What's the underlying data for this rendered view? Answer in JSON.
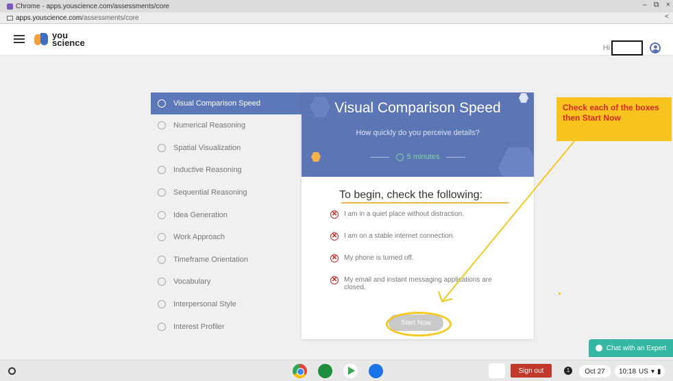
{
  "browser": {
    "title": "Chrome - apps.youscience.com/assessments/core",
    "url_domain": "apps.youscience.com",
    "url_path": "/assessments/core",
    "min": "–",
    "restore": "⧉",
    "close": "×",
    "share": "<"
  },
  "header": {
    "logo_line1": "you",
    "logo_line2": "science",
    "greeting": "Hi"
  },
  "sidebar": {
    "items": [
      {
        "label": "Visual Comparison Speed",
        "icon": "eye-icon"
      },
      {
        "label": "Numerical Reasoning",
        "icon": "numbers-icon"
      },
      {
        "label": "Spatial Visualization",
        "icon": "cube-icon"
      },
      {
        "label": "Inductive Reasoning",
        "icon": "search-icon"
      },
      {
        "label": "Sequential Reasoning",
        "icon": "layers-icon"
      },
      {
        "label": "Idea Generation",
        "icon": "lightbulb-icon"
      },
      {
        "label": "Work Approach",
        "icon": "briefcase-icon"
      },
      {
        "label": "Timeframe Orientation",
        "icon": "clock-icon"
      },
      {
        "label": "Vocabulary",
        "icon": "book-icon"
      },
      {
        "label": "Interpersonal Style",
        "icon": "chat-icon"
      },
      {
        "label": "Interest Profiler",
        "icon": "people-icon"
      }
    ]
  },
  "card": {
    "title": "Visual Comparison Speed",
    "subtitle": "How quickly do you perceive details?",
    "duration": "5 minutes",
    "begin_heading": "To begin, check the following:",
    "checks": [
      "I am in a quiet place without distraction.",
      "I am on a stable internet connection.",
      "My phone is turned off.",
      "My email and instant messaging applications are closed."
    ],
    "start_label": "Start Now"
  },
  "annotation": {
    "note": "Check each of the boxes then Start Now",
    "color": "#f7c41f"
  },
  "chat": {
    "label": "Chat with an Expert"
  },
  "taskbar": {
    "signout": "Sign out",
    "notif_count": "1",
    "date": "Oct 27",
    "time": "10:18",
    "region": "US"
  }
}
